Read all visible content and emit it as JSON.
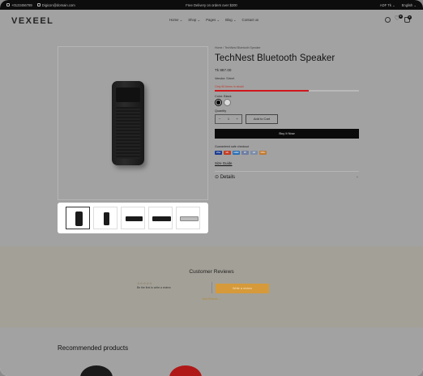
{
  "topbar": {
    "phone": "+0123456789",
    "email": "Digicon@domain.com",
    "announcement": "Free Delivery on orders over $200",
    "currency": "ADF Tk ⌄",
    "language": "English ⌄"
  },
  "header": {
    "logo": "VEXEEL",
    "nav": [
      "Home ⌄",
      "Shop ⌄",
      "Pages ⌄",
      "Blog ⌄",
      "Contact us"
    ],
    "wishlist_count": "0",
    "cart_count": "0"
  },
  "product": {
    "breadcrumb": "Home  /  TechNest Bluetooth Speaker",
    "title": "TechNest Bluetooth Speaker",
    "price": "Tk 887.00",
    "vendor_label": "Vendor:",
    "vendor": "Street",
    "stock_text": "Only 80 items in stock!",
    "stock_fill": 0.65,
    "color_label": "Color: Black",
    "quantity_label": "Quantity",
    "quantity_value": "1",
    "qty_minus": "−",
    "qty_plus": "+",
    "add_to_cart": "Add to Cart",
    "buy_now": "Buy It Now",
    "guarantee": "Guaranteed safe checkout",
    "payments": [
      "VISA",
      "MC",
      "AMEX",
      "PP",
      "GP",
      "DISC"
    ],
    "size_guide": "Size Guide",
    "details_label": "Details",
    "details_chevron": "⌄"
  },
  "reviews": {
    "title": "Customer Reviews",
    "stars": "☆☆☆☆☆",
    "first_review": "Be the first to write a review",
    "write_button": "Write a review",
    "more": "Best Reviews  ⌄"
  },
  "recommended": {
    "title": "Recommended products"
  },
  "colors": {
    "accent": "#d69a3a",
    "stock_bar": "#d0161c",
    "buy_now": "#0b0b0b"
  }
}
